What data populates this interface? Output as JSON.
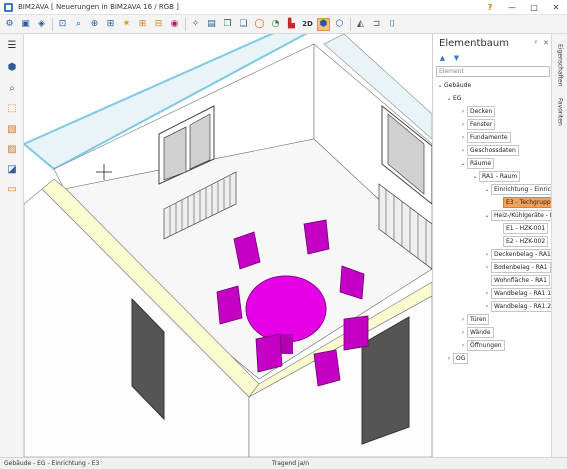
{
  "window": {
    "title": "BIM2AVA [ Neuerungen in BIM2AVA 16 /  RGB ]",
    "help": "?",
    "minimize": "—",
    "maximize": "□",
    "close": "✕"
  },
  "toolbar": {
    "icons": [
      "cube-settings-icon",
      "cube-icon",
      "cube-alt-icon",
      "zoom-select-icon",
      "zoom-window-icon",
      "zoom-fit-icon",
      "zoom-all-icon",
      "sun-icon",
      "plus-box-icon",
      "minus-box-icon",
      "color-wheel-icon",
      "wand-icon",
      "window-icon",
      "copy-window-icon",
      "stack-window-icon",
      "ring-icon",
      "pie-icon",
      "chart-icon",
      "text-2d-icon",
      "cube-3d-icon",
      "prism-icon",
      "triangle-icon",
      "bracket-icon",
      "camera-icon"
    ],
    "label_2d": "2D"
  },
  "lefttools": {
    "icons": [
      "menu-icon",
      "cube-view-icon",
      "zoom-icon",
      "select-box-icon",
      "layer-icon",
      "filter-icon",
      "section-icon",
      "folder-icon"
    ]
  },
  "panel": {
    "title": "Elementbaum",
    "pin": "ᵖ",
    "close": "✕",
    "search_placeholder": "Element",
    "tree": [
      {
        "label": "Gebäude",
        "caret": "⌄"
      },
      {
        "label": "EG",
        "caret": "⌄"
      },
      {
        "label": "Decken",
        "caret": "›"
      },
      {
        "label": "Fenster",
        "caret": "›"
      },
      {
        "label": "Fundamente",
        "caret": "›"
      },
      {
        "label": "Geschossdaten",
        "caret": "›"
      },
      {
        "label": "Räume",
        "caret": "⌄"
      },
      {
        "label": "RA1 - Raum",
        "caret": "⌄"
      },
      {
        "label": "Einrichtung - Einrich",
        "caret": "⌄"
      },
      {
        "label": "E3 - Techgrupp",
        "caret": ""
      },
      {
        "label": "Heiz-/Kühlgeräte - H",
        "caret": "⌄"
      },
      {
        "label": "E1 - HZK-001",
        "caret": ""
      },
      {
        "label": "E2 - HZK-002",
        "caret": ""
      },
      {
        "label": "Deckenbelag - RA1",
        "caret": "›"
      },
      {
        "label": "Bodenbelag - RA1",
        "caret": "›"
      },
      {
        "label": "Wohnfläche - RA1",
        "caret": ""
      },
      {
        "label": "Wandbelag - RA1.1",
        "caret": "›"
      },
      {
        "label": "Wandbelag - RA1.2",
        "caret": "›"
      },
      {
        "label": "Türen",
        "caret": "›"
      },
      {
        "label": "Wände",
        "caret": "›"
      },
      {
        "label": "Öffnungen",
        "caret": "›"
      },
      {
        "label": "OG",
        "caret": "›"
      }
    ]
  },
  "sidetabs": {
    "tab1": "Eigenschaften",
    "tab2": "Favoriten"
  },
  "status": {
    "left": "Gebäude - EG - Einrichtung - E3",
    "mid": "Tragend ja/n"
  },
  "colors": {
    "accent": "#f4a25a",
    "furniture": "#c400c4",
    "table": "#e600e6",
    "wall_edge": "#f6f3a8"
  }
}
